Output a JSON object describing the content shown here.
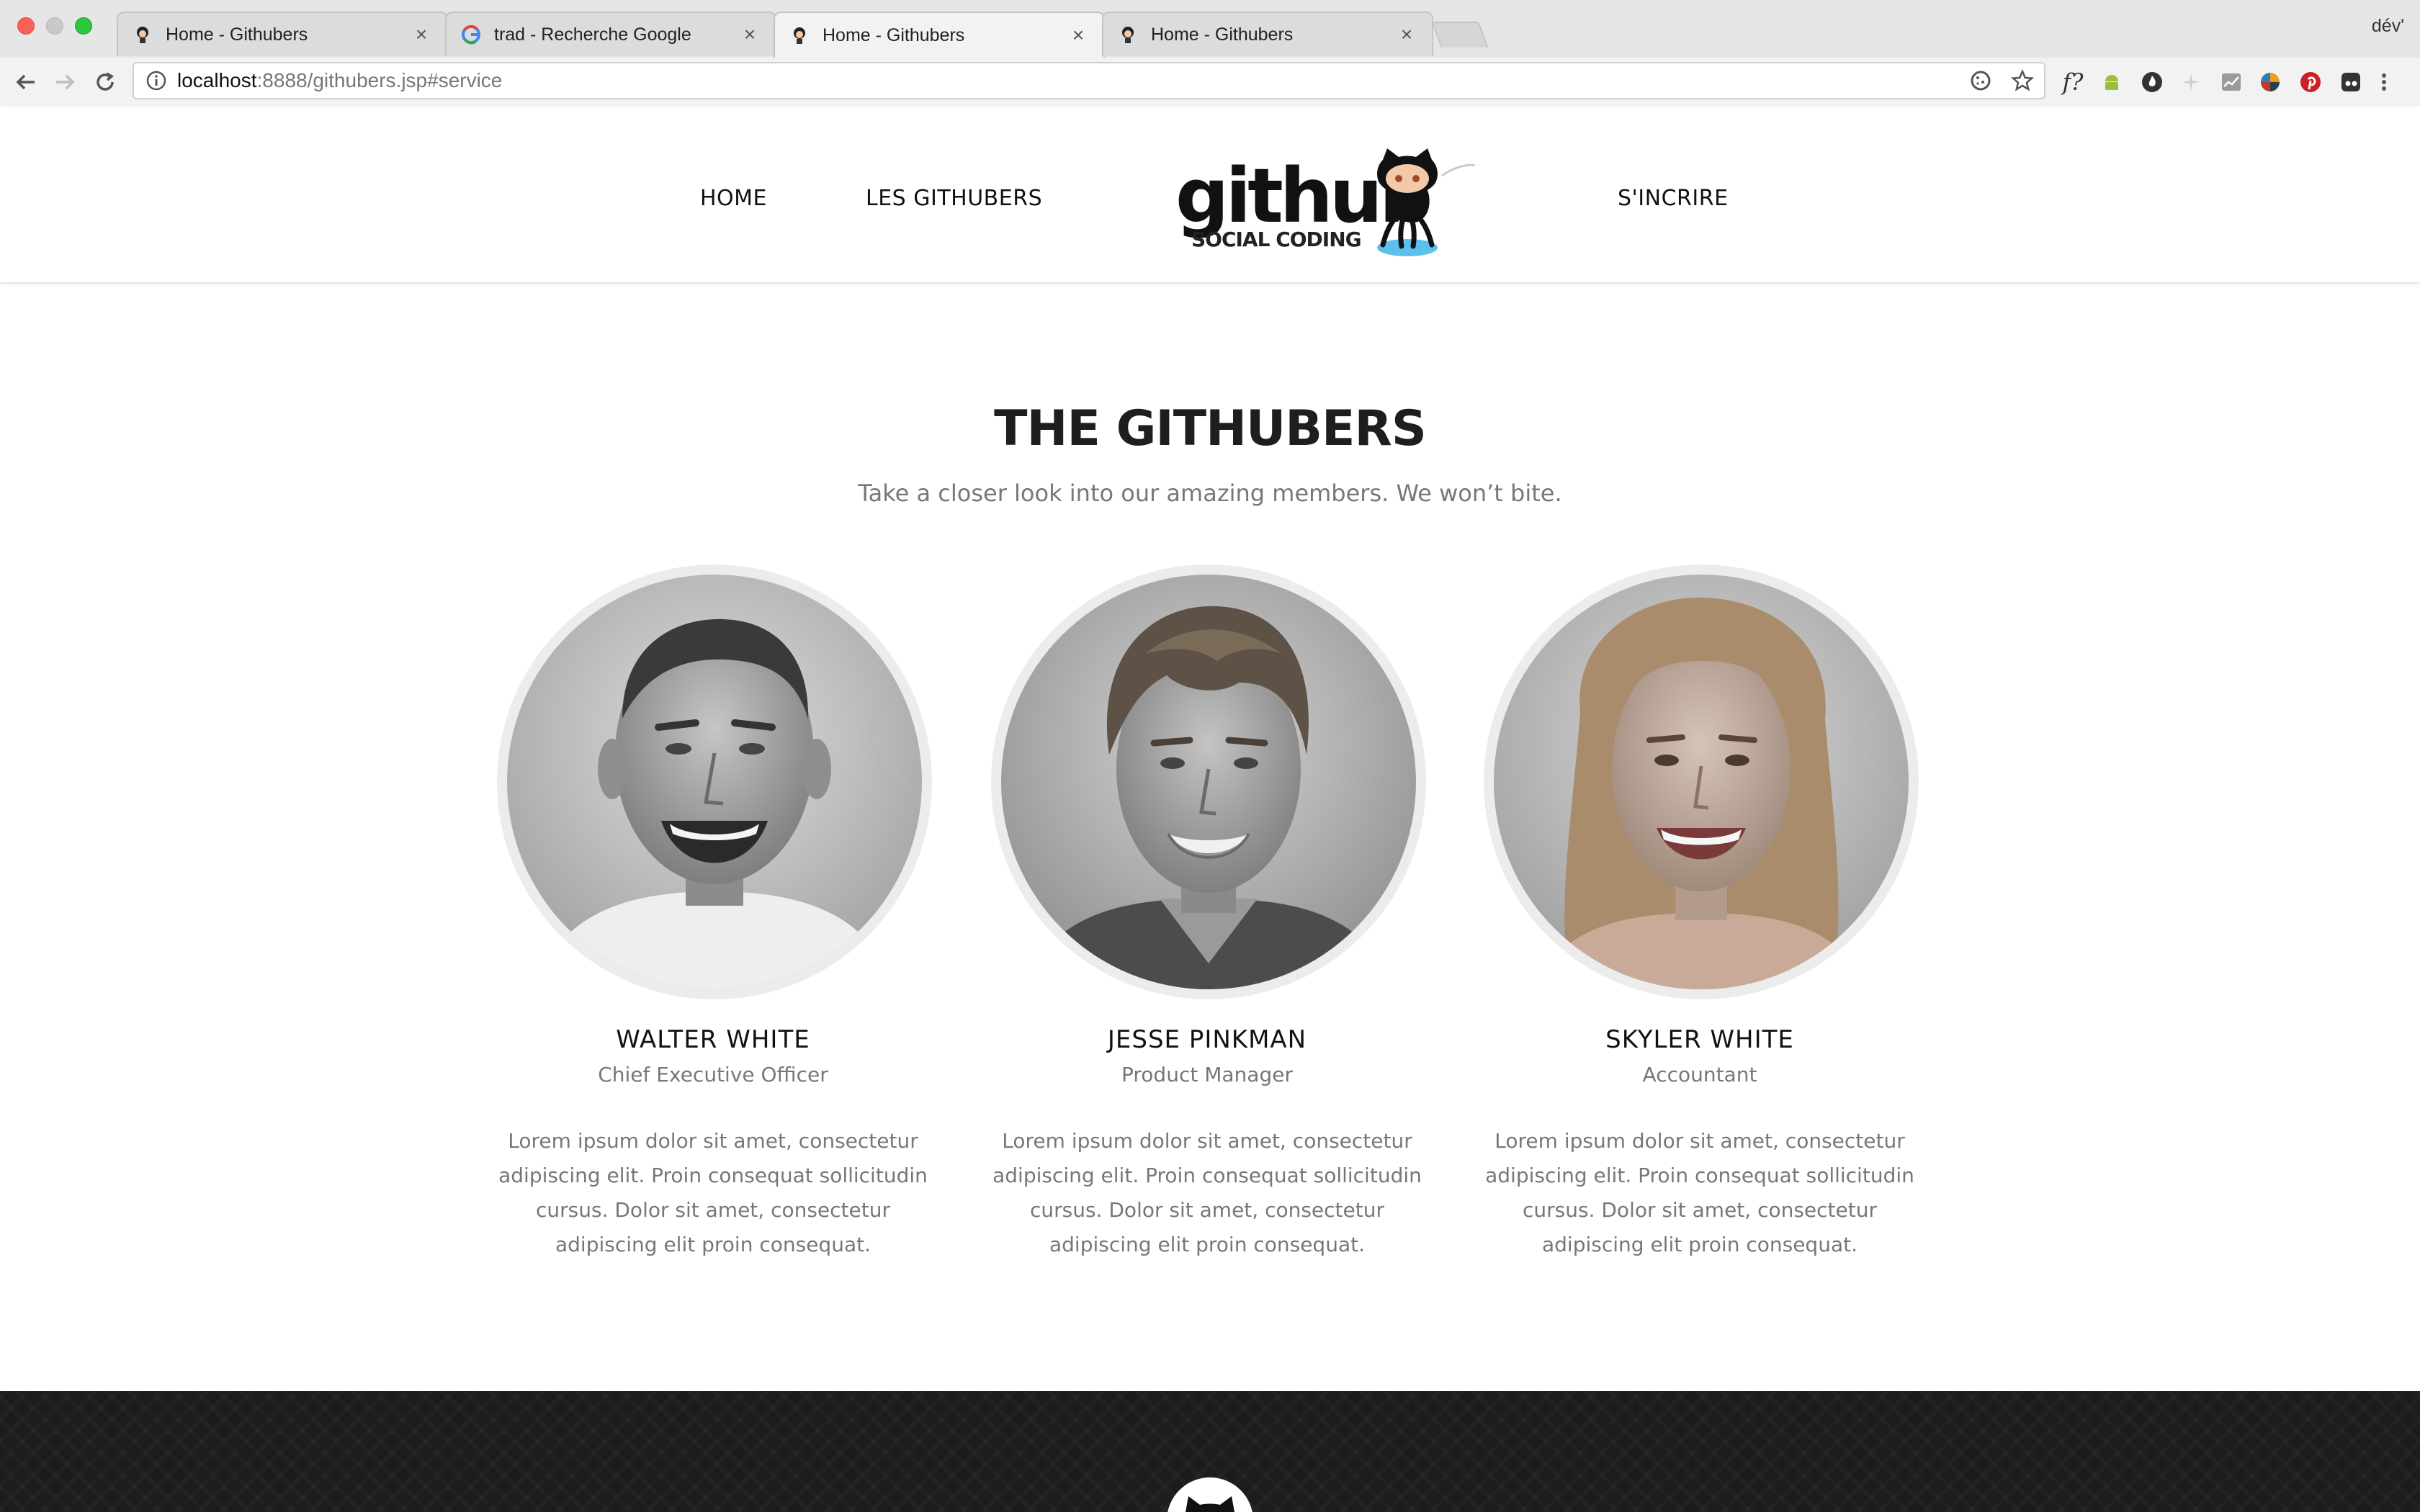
{
  "browser": {
    "tabs": [
      {
        "title": "Home - Githubers",
        "active": false
      },
      {
        "title": "trad - Recherche Google",
        "active": false
      },
      {
        "title": "Home - Githubers",
        "active": true
      },
      {
        "title": "Home - Githubers",
        "active": false
      }
    ],
    "close_glyph": "×",
    "profile": "dév'",
    "url_host": "localhost",
    "url_path": ":8888/githubers.jsp#service",
    "ext_f_label": "f?"
  },
  "site": {
    "nav": {
      "home": "HOME",
      "githubers": "LES GITHUBERS",
      "signup": "S'INCRIRE"
    },
    "logo": {
      "word": "github",
      "tagline": "SOCIAL CODING"
    }
  },
  "team": {
    "title": "THE GITHUBERS",
    "subtitle": "Take a closer look into our amazing members. We won’t bite.",
    "members": [
      {
        "name": "WALTER WHITE",
        "role": "Chief Executive Officer",
        "bio": "Lorem ipsum dolor sit amet, consectetur adipiscing elit. Proin consequat sollicitudin cursus. Dolor sit amet, consectetur adipiscing elit proin consequat."
      },
      {
        "name": "JESSE PINKMAN",
        "role": "Product Manager",
        "bio": "Lorem ipsum dolor sit amet, consectetur adipiscing elit. Proin consequat sollicitudin cursus. Dolor sit amet, consectetur adipiscing elit proin consequat."
      },
      {
        "name": "SKYLER WHITE",
        "role": "Accountant",
        "bio": "Lorem ipsum dolor sit amet, consectetur adipiscing elit. Proin consequat sollicitudin cursus. Dolor sit amet, consectetur adipiscing elit proin consequat."
      }
    ]
  },
  "colors": {
    "footer_bg": "#1c1c1c",
    "heading": "#1e1e1e",
    "muted_text": "#777777",
    "close_button": "#fc5f57"
  }
}
